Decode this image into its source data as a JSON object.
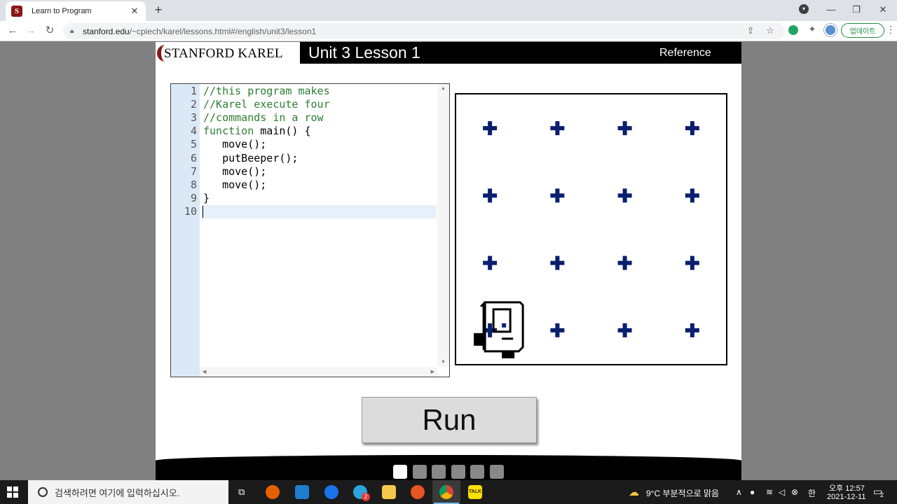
{
  "browser": {
    "tab_title": "Learn to Program",
    "favicon_letter": "S",
    "url_host": "stanford.edu",
    "url_path": "/~cpiech/karel/lessons.html#/english/unit3/lesson1",
    "update_label": "업데이트"
  },
  "page": {
    "logo_text": "STANFORD KAREL",
    "lesson_title": "Unit 3 Lesson 1",
    "reference_label": "Reference",
    "run_label": "Run"
  },
  "editor": {
    "line_numbers": [
      "1",
      "2",
      "3",
      "4",
      "5",
      "6",
      "7",
      "8",
      "9",
      "10"
    ],
    "lines": [
      {
        "text": "//this program makes",
        "kind": "comment"
      },
      {
        "text": "//Karel execute four",
        "kind": "comment"
      },
      {
        "text": "//commands in a row",
        "kind": "comment"
      },
      {
        "text": "function main() {",
        "kind": "function"
      },
      {
        "text": "   move();",
        "kind": "code"
      },
      {
        "text": "   putBeeper();",
        "kind": "code"
      },
      {
        "text": "   move();",
        "kind": "code"
      },
      {
        "text": "   move();",
        "kind": "code"
      },
      {
        "text": "}",
        "kind": "code"
      },
      {
        "text": "",
        "kind": "code"
      }
    ]
  },
  "world": {
    "rows": 4,
    "cols": 4,
    "karel": {
      "row": 1,
      "col": 1,
      "facing": "east"
    },
    "beeper_color": "#0a1f6e"
  },
  "lesson_dots": {
    "total": 6,
    "active": 1
  },
  "taskbar": {
    "search_placeholder": "검색하려면 여기에 입력하십시오.",
    "weather": "9°C  부분적으로 맑음",
    "ime": "한",
    "time": "오후 12:57",
    "date": "2021-12-11",
    "notification_count": "2",
    "telegram_badge": "2",
    "kakao_label": "TALK"
  }
}
